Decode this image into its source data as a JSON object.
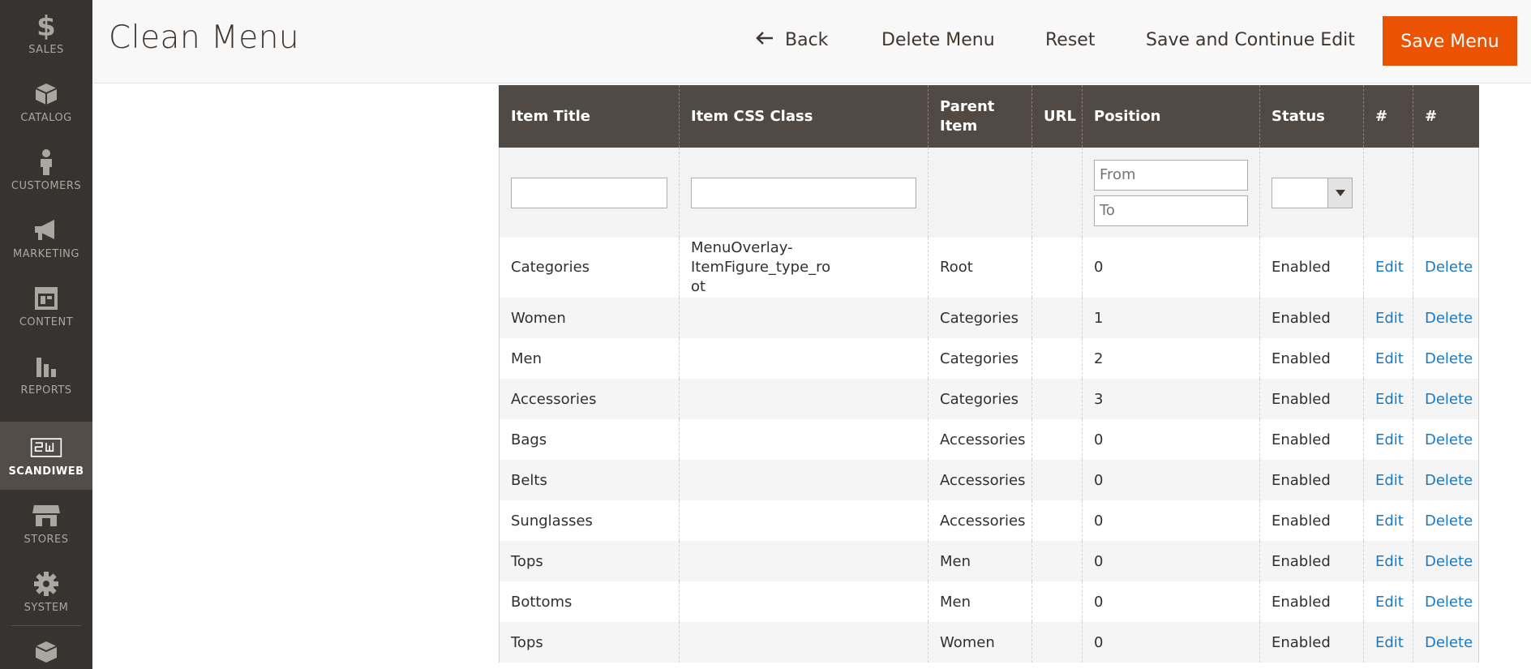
{
  "sidebar": {
    "items": [
      {
        "label": "SALES",
        "icon": "dollar-icon"
      },
      {
        "label": "CATALOG",
        "icon": "box-icon"
      },
      {
        "label": "CUSTOMERS",
        "icon": "person-icon"
      },
      {
        "label": "MARKETING",
        "icon": "megaphone-icon"
      },
      {
        "label": "CONTENT",
        "icon": "layout-icon"
      },
      {
        "label": "REPORTS",
        "icon": "bar-chart-icon"
      },
      {
        "label": "SCANDIWEB",
        "icon": "scandiweb-logo-icon"
      },
      {
        "label": "STORES",
        "icon": "storefront-icon"
      },
      {
        "label": "SYSTEM",
        "icon": "gear-icon"
      }
    ]
  },
  "header": {
    "title": "Clean Menu",
    "back_label": "Back",
    "delete_label": "Delete Menu",
    "reset_label": "Reset",
    "save_continue_label": "Save and Continue Edit",
    "save_label": "Save Menu"
  },
  "grid": {
    "columns": [
      "Item Title",
      "Item CSS Class",
      "Parent Item",
      "URL",
      "Position",
      "Status",
      "#",
      "#"
    ],
    "filters": {
      "title_value": "",
      "css_value": "",
      "position_from_placeholder": "From",
      "position_to_placeholder": "To",
      "status_value": ""
    },
    "rows": [
      {
        "title": "Categories",
        "css": "MenuOverlay-ItemFigure_type_root",
        "parent": "Root",
        "url": "",
        "position": "0",
        "status": "Enabled",
        "edit": "Edit",
        "delete": "Delete"
      },
      {
        "title": "Women",
        "css": "",
        "parent": "Categories",
        "url": "",
        "position": "1",
        "status": "Enabled",
        "edit": "Edit",
        "delete": "Delete"
      },
      {
        "title": "Men",
        "css": "",
        "parent": "Categories",
        "url": "",
        "position": "2",
        "status": "Enabled",
        "edit": "Edit",
        "delete": "Delete"
      },
      {
        "title": "Accessories",
        "css": "",
        "parent": "Categories",
        "url": "",
        "position": "3",
        "status": "Enabled",
        "edit": "Edit",
        "delete": "Delete"
      },
      {
        "title": "Bags",
        "css": "",
        "parent": "Accessories",
        "url": "",
        "position": "0",
        "status": "Enabled",
        "edit": "Edit",
        "delete": "Delete"
      },
      {
        "title": "Belts",
        "css": "",
        "parent": "Accessories",
        "url": "",
        "position": "0",
        "status": "Enabled",
        "edit": "Edit",
        "delete": "Delete"
      },
      {
        "title": "Sunglasses",
        "css": "",
        "parent": "Accessories",
        "url": "",
        "position": "0",
        "status": "Enabled",
        "edit": "Edit",
        "delete": "Delete"
      },
      {
        "title": "Tops",
        "css": "",
        "parent": "Men",
        "url": "",
        "position": "0",
        "status": "Enabled",
        "edit": "Edit",
        "delete": "Delete"
      },
      {
        "title": "Bottoms",
        "css": "",
        "parent": "Men",
        "url": "",
        "position": "0",
        "status": "Enabled",
        "edit": "Edit",
        "delete": "Delete"
      },
      {
        "title": "Tops",
        "css": "",
        "parent": "Women",
        "url": "",
        "position": "0",
        "status": "Enabled",
        "edit": "Edit",
        "delete": "Delete"
      }
    ]
  },
  "colors": {
    "sidebar_bg": "#373330",
    "grid_header_bg": "#514943",
    "primary_button": "#eb5202",
    "link": "#1979c3"
  }
}
